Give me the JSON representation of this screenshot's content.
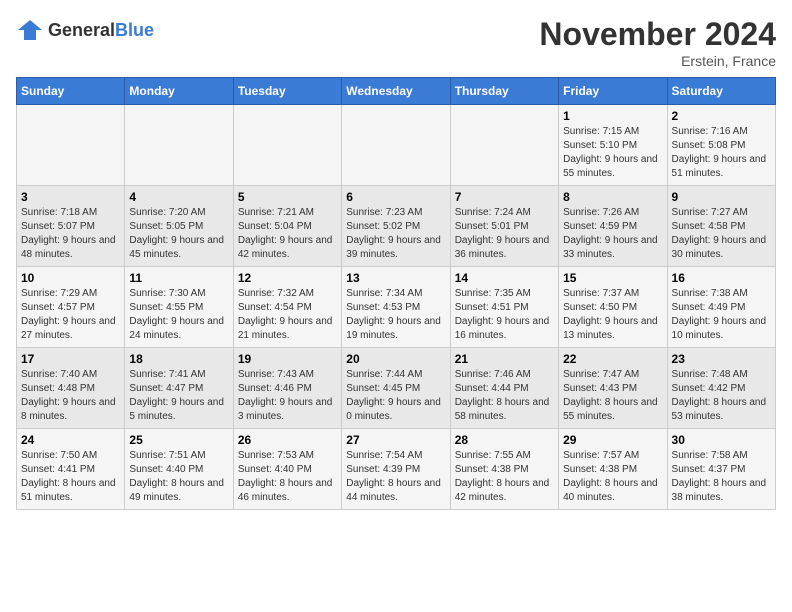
{
  "header": {
    "logo_general": "General",
    "logo_blue": "Blue",
    "month_title": "November 2024",
    "location": "Erstein, France"
  },
  "weekdays": [
    "Sunday",
    "Monday",
    "Tuesday",
    "Wednesday",
    "Thursday",
    "Friday",
    "Saturday"
  ],
  "weeks": [
    [
      {
        "day": "",
        "sunrise": "",
        "sunset": "",
        "daylight": ""
      },
      {
        "day": "",
        "sunrise": "",
        "sunset": "",
        "daylight": ""
      },
      {
        "day": "",
        "sunrise": "",
        "sunset": "",
        "daylight": ""
      },
      {
        "day": "",
        "sunrise": "",
        "sunset": "",
        "daylight": ""
      },
      {
        "day": "",
        "sunrise": "",
        "sunset": "",
        "daylight": ""
      },
      {
        "day": "1",
        "sunrise": "Sunrise: 7:15 AM",
        "sunset": "Sunset: 5:10 PM",
        "daylight": "Daylight: 9 hours and 55 minutes."
      },
      {
        "day": "2",
        "sunrise": "Sunrise: 7:16 AM",
        "sunset": "Sunset: 5:08 PM",
        "daylight": "Daylight: 9 hours and 51 minutes."
      }
    ],
    [
      {
        "day": "3",
        "sunrise": "Sunrise: 7:18 AM",
        "sunset": "Sunset: 5:07 PM",
        "daylight": "Daylight: 9 hours and 48 minutes."
      },
      {
        "day": "4",
        "sunrise": "Sunrise: 7:20 AM",
        "sunset": "Sunset: 5:05 PM",
        "daylight": "Daylight: 9 hours and 45 minutes."
      },
      {
        "day": "5",
        "sunrise": "Sunrise: 7:21 AM",
        "sunset": "Sunset: 5:04 PM",
        "daylight": "Daylight: 9 hours and 42 minutes."
      },
      {
        "day": "6",
        "sunrise": "Sunrise: 7:23 AM",
        "sunset": "Sunset: 5:02 PM",
        "daylight": "Daylight: 9 hours and 39 minutes."
      },
      {
        "day": "7",
        "sunrise": "Sunrise: 7:24 AM",
        "sunset": "Sunset: 5:01 PM",
        "daylight": "Daylight: 9 hours and 36 minutes."
      },
      {
        "day": "8",
        "sunrise": "Sunrise: 7:26 AM",
        "sunset": "Sunset: 4:59 PM",
        "daylight": "Daylight: 9 hours and 33 minutes."
      },
      {
        "day": "9",
        "sunrise": "Sunrise: 7:27 AM",
        "sunset": "Sunset: 4:58 PM",
        "daylight": "Daylight: 9 hours and 30 minutes."
      }
    ],
    [
      {
        "day": "10",
        "sunrise": "Sunrise: 7:29 AM",
        "sunset": "Sunset: 4:57 PM",
        "daylight": "Daylight: 9 hours and 27 minutes."
      },
      {
        "day": "11",
        "sunrise": "Sunrise: 7:30 AM",
        "sunset": "Sunset: 4:55 PM",
        "daylight": "Daylight: 9 hours and 24 minutes."
      },
      {
        "day": "12",
        "sunrise": "Sunrise: 7:32 AM",
        "sunset": "Sunset: 4:54 PM",
        "daylight": "Daylight: 9 hours and 21 minutes."
      },
      {
        "day": "13",
        "sunrise": "Sunrise: 7:34 AM",
        "sunset": "Sunset: 4:53 PM",
        "daylight": "Daylight: 9 hours and 19 minutes."
      },
      {
        "day": "14",
        "sunrise": "Sunrise: 7:35 AM",
        "sunset": "Sunset: 4:51 PM",
        "daylight": "Daylight: 9 hours and 16 minutes."
      },
      {
        "day": "15",
        "sunrise": "Sunrise: 7:37 AM",
        "sunset": "Sunset: 4:50 PM",
        "daylight": "Daylight: 9 hours and 13 minutes."
      },
      {
        "day": "16",
        "sunrise": "Sunrise: 7:38 AM",
        "sunset": "Sunset: 4:49 PM",
        "daylight": "Daylight: 9 hours and 10 minutes."
      }
    ],
    [
      {
        "day": "17",
        "sunrise": "Sunrise: 7:40 AM",
        "sunset": "Sunset: 4:48 PM",
        "daylight": "Daylight: 9 hours and 8 minutes."
      },
      {
        "day": "18",
        "sunrise": "Sunrise: 7:41 AM",
        "sunset": "Sunset: 4:47 PM",
        "daylight": "Daylight: 9 hours and 5 minutes."
      },
      {
        "day": "19",
        "sunrise": "Sunrise: 7:43 AM",
        "sunset": "Sunset: 4:46 PM",
        "daylight": "Daylight: 9 hours and 3 minutes."
      },
      {
        "day": "20",
        "sunrise": "Sunrise: 7:44 AM",
        "sunset": "Sunset: 4:45 PM",
        "daylight": "Daylight: 9 hours and 0 minutes."
      },
      {
        "day": "21",
        "sunrise": "Sunrise: 7:46 AM",
        "sunset": "Sunset: 4:44 PM",
        "daylight": "Daylight: 8 hours and 58 minutes."
      },
      {
        "day": "22",
        "sunrise": "Sunrise: 7:47 AM",
        "sunset": "Sunset: 4:43 PM",
        "daylight": "Daylight: 8 hours and 55 minutes."
      },
      {
        "day": "23",
        "sunrise": "Sunrise: 7:48 AM",
        "sunset": "Sunset: 4:42 PM",
        "daylight": "Daylight: 8 hours and 53 minutes."
      }
    ],
    [
      {
        "day": "24",
        "sunrise": "Sunrise: 7:50 AM",
        "sunset": "Sunset: 4:41 PM",
        "daylight": "Daylight: 8 hours and 51 minutes."
      },
      {
        "day": "25",
        "sunrise": "Sunrise: 7:51 AM",
        "sunset": "Sunset: 4:40 PM",
        "daylight": "Daylight: 8 hours and 49 minutes."
      },
      {
        "day": "26",
        "sunrise": "Sunrise: 7:53 AM",
        "sunset": "Sunset: 4:40 PM",
        "daylight": "Daylight: 8 hours and 46 minutes."
      },
      {
        "day": "27",
        "sunrise": "Sunrise: 7:54 AM",
        "sunset": "Sunset: 4:39 PM",
        "daylight": "Daylight: 8 hours and 44 minutes."
      },
      {
        "day": "28",
        "sunrise": "Sunrise: 7:55 AM",
        "sunset": "Sunset: 4:38 PM",
        "daylight": "Daylight: 8 hours and 42 minutes."
      },
      {
        "day": "29",
        "sunrise": "Sunrise: 7:57 AM",
        "sunset": "Sunset: 4:38 PM",
        "daylight": "Daylight: 8 hours and 40 minutes."
      },
      {
        "day": "30",
        "sunrise": "Sunrise: 7:58 AM",
        "sunset": "Sunset: 4:37 PM",
        "daylight": "Daylight: 8 hours and 38 minutes."
      }
    ]
  ]
}
